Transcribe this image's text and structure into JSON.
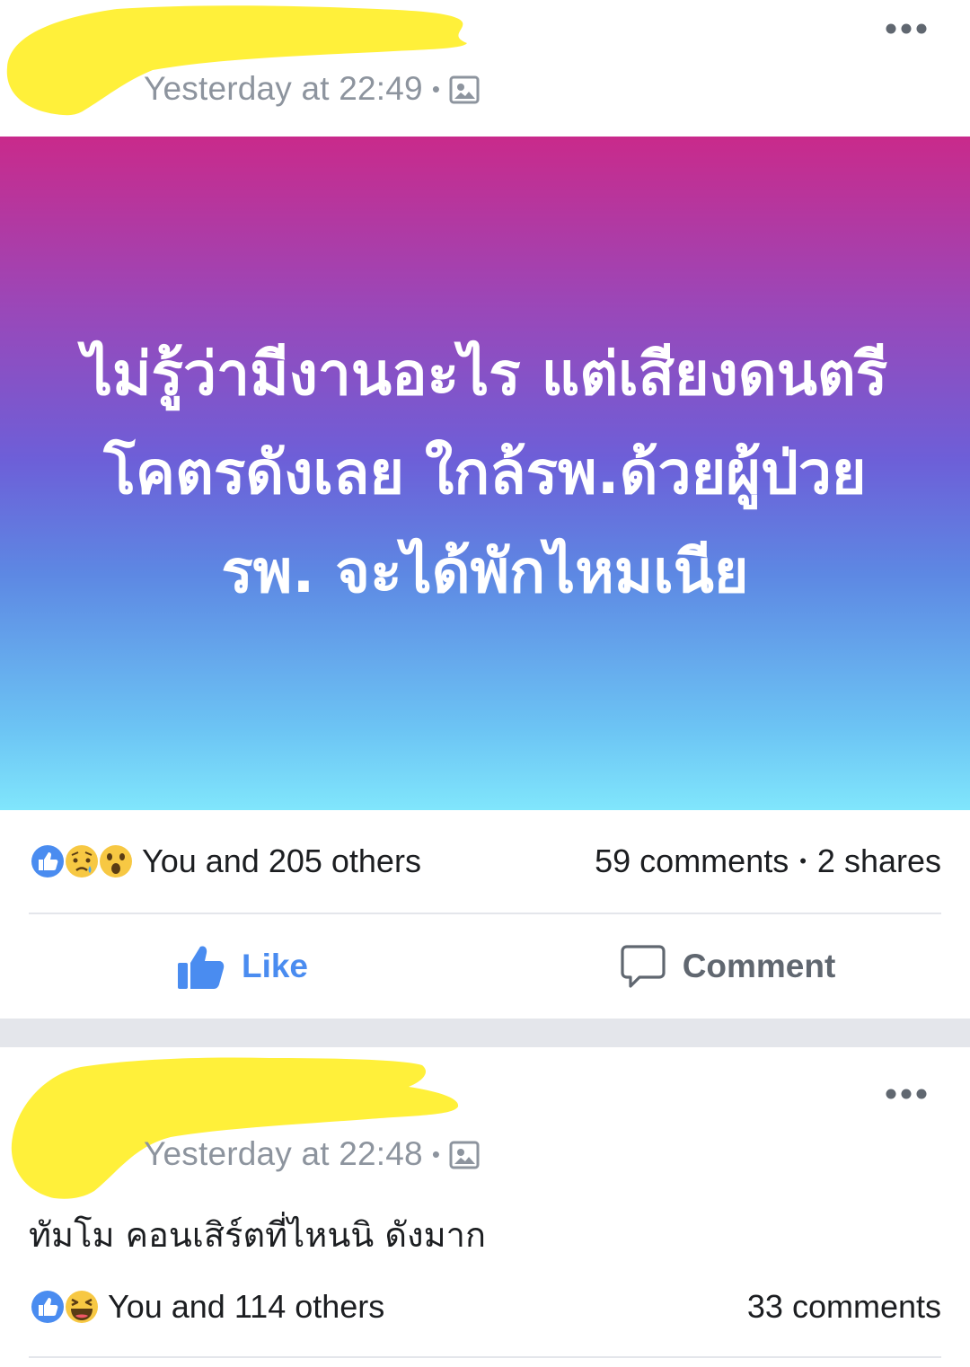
{
  "colors": {
    "like_blue": "#4a8cf0",
    "redaction_yellow": "#fff03a",
    "separator_gray": "#e4e6eb",
    "meta_gray": "#8d949e"
  },
  "posts": [
    {
      "timestamp": "Yesterday at 22:49",
      "separator": "•",
      "privacy_icon": "photo-audience-icon",
      "menu_icon": "more-options-icon",
      "body_text": "ไม่รู้ว่ามีงานอะไร แต่เสียงดนตรีโคตรดังเลย ใกล้รพ.ด้วยผู้ป่วยรพ. จะได้พักไหมเนีย",
      "reactions": [
        "like",
        "sad",
        "wow"
      ],
      "reaction_summary": "You and 205 others",
      "comments": "59 comments",
      "stats_separator": "•",
      "shares": "2 shares",
      "like_label": "Like",
      "comment_label": "Comment"
    },
    {
      "timestamp": "Yesterday at 22:48",
      "separator": "•",
      "privacy_icon": "photo-audience-icon",
      "menu_icon": "more-options-icon",
      "body_text": "ทัมโม คอนเสิร์ตที่ไหนนิ ดังมาก",
      "reactions": [
        "like",
        "haha"
      ],
      "reaction_summary": "You and 114 others",
      "comments": "33 comments"
    }
  ]
}
